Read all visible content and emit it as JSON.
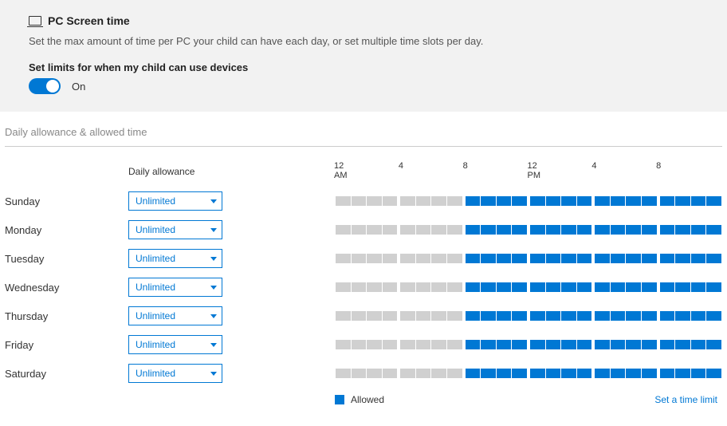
{
  "header": {
    "title": "PC Screen time",
    "subtitle": "Set the max amount of time per PC your child can have each day, or set multiple time slots per day.",
    "toggle_label": "Set limits for when my child can use devices",
    "toggle_state": "On"
  },
  "section_label": "Daily allowance & allowed time",
  "columns": {
    "allowance": "Daily allowance"
  },
  "axis_ticks": [
    {
      "pos": 0,
      "label": "12\nAM"
    },
    {
      "pos": 16.67,
      "label": "4"
    },
    {
      "pos": 33.33,
      "label": "8"
    },
    {
      "pos": 50,
      "label": "12\nPM"
    },
    {
      "pos": 66.67,
      "label": "4"
    },
    {
      "pos": 83.33,
      "label": "8"
    }
  ],
  "days": [
    {
      "name": "Sunday",
      "allowance": "Unlimited"
    },
    {
      "name": "Monday",
      "allowance": "Unlimited"
    },
    {
      "name": "Tuesday",
      "allowance": "Unlimited"
    },
    {
      "name": "Wednesday",
      "allowance": "Unlimited"
    },
    {
      "name": "Thursday",
      "allowance": "Unlimited"
    },
    {
      "name": "Friday",
      "allowance": "Unlimited"
    },
    {
      "name": "Saturday",
      "allowance": "Unlimited"
    }
  ],
  "slot_pattern": {
    "allowed_from_hour": 8,
    "allowed_to_hour": 23,
    "total_hours": 24
  },
  "legend": {
    "allowed": "Allowed",
    "link": "Set a time limit"
  }
}
